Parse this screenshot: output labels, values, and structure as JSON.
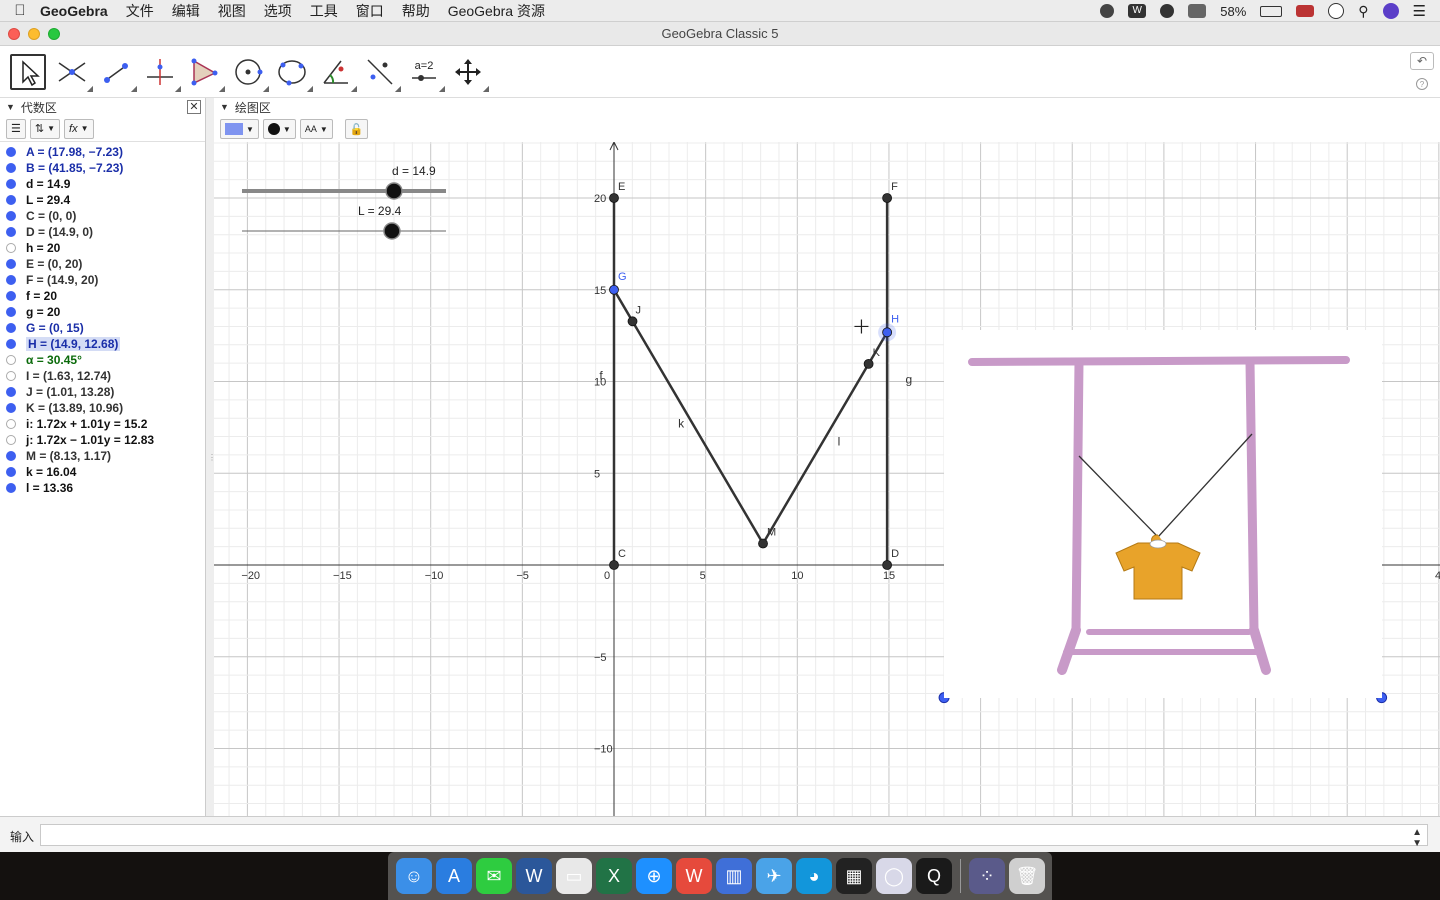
{
  "menubar": {
    "app_name": "GeoGebra",
    "items": [
      "文件",
      "编辑",
      "视图",
      "选项",
      "工具",
      "窗口",
      "帮助",
      "GeoGebra 资源"
    ],
    "battery": "58%",
    "status_icons": [
      "record-icon",
      "wps-icon",
      "sync-icon",
      "cloud-icon",
      "battery-icon",
      "flag-icon",
      "clock-icon",
      "search-icon",
      "siri-icon",
      "list-icon"
    ]
  },
  "window": {
    "title": "GeoGebra Classic 5"
  },
  "toolbar": {
    "tools": [
      "move-tool",
      "point-intersect-tool",
      "line-tool",
      "perpendicular-tool",
      "polygon-tool",
      "circle-tool",
      "circle-three-points-tool",
      "angle-tool",
      "reflect-tool",
      "slider-tool",
      "move-graphics-tool"
    ],
    "slider_tool_label": "a=2",
    "undo": "↶",
    "help": "?"
  },
  "algebra": {
    "title": "代数区",
    "close": "✕",
    "fx_label": "fx",
    "rows": [
      {
        "text": "A = (17.98, −7.23)",
        "visible": true,
        "color": "#1a2ea8"
      },
      {
        "text": "B = (41.85, −7.23)",
        "visible": true,
        "color": "#1a2ea8"
      },
      {
        "text": "d = 14.9",
        "visible": true,
        "color": "#111111"
      },
      {
        "text": "L = 29.4",
        "visible": true,
        "color": "#111111"
      },
      {
        "text": "C = (0, 0)",
        "visible": true,
        "color": "#333333"
      },
      {
        "text": "D = (14.9, 0)",
        "visible": true,
        "color": "#333333"
      },
      {
        "text": "h = 20",
        "visible": false,
        "color": "#111111"
      },
      {
        "text": "E = (0, 20)",
        "visible": true,
        "color": "#333333"
      },
      {
        "text": "F = (14.9, 20)",
        "visible": true,
        "color": "#333333"
      },
      {
        "text": "f = 20",
        "visible": true,
        "color": "#111111"
      },
      {
        "text": "g = 20",
        "visible": true,
        "color": "#111111"
      },
      {
        "text": "G = (0, 15)",
        "visible": true,
        "color": "#1a2ea8"
      },
      {
        "text": "H = (14.9, 12.68)",
        "visible": true,
        "color": "#1a2ea8",
        "selected": true
      },
      {
        "text": "α = 30.45°",
        "visible": false,
        "color": "#0a6a0a"
      },
      {
        "text": "I = (1.63, 12.74)",
        "visible": false,
        "color": "#333333"
      },
      {
        "text": "J = (1.01, 13.28)",
        "visible": true,
        "color": "#333333"
      },
      {
        "text": "K = (13.89, 10.96)",
        "visible": true,
        "color": "#333333"
      },
      {
        "text": "i: 1.72x + 1.01y = 15.2",
        "visible": false,
        "color": "#111111"
      },
      {
        "text": "j: 1.72x − 1.01y = 12.83",
        "visible": false,
        "color": "#111111"
      },
      {
        "text": "M = (8.13, 1.17)",
        "visible": true,
        "color": "#333333"
      },
      {
        "text": "k = 16.04",
        "visible": true,
        "color": "#111111"
      },
      {
        "text": "l = 13.36",
        "visible": true,
        "color": "#111111"
      }
    ]
  },
  "graphics": {
    "title": "绘图区",
    "accent_color": "#7f94f0",
    "font_button": "AA",
    "x_ticks": [
      "−20",
      "−15",
      "−10",
      "−5",
      "0",
      "5",
      "10",
      "15",
      "4"
    ],
    "y_ticks": [
      "20",
      "15",
      "10",
      "5",
      "−5",
      "−10"
    ],
    "sliders": [
      {
        "label": "d = 14.9",
        "min": 0,
        "max": 20,
        "value": 14.9
      },
      {
        "label": "L = 29.4",
        "min": 0,
        "max": 40,
        "value": 29.4
      }
    ],
    "point_labels": [
      "E",
      "F",
      "G",
      "H",
      "J",
      "K",
      "M",
      "C",
      "D"
    ],
    "segment_labels": [
      "k",
      "l",
      "f",
      "g"
    ],
    "points": {
      "C": [
        0,
        0
      ],
      "D": [
        14.9,
        0
      ],
      "E": [
        0,
        20
      ],
      "F": [
        14.9,
        20
      ],
      "G": [
        0,
        15
      ],
      "H": [
        14.9,
        12.68
      ],
      "J": [
        1.01,
        13.28
      ],
      "K": [
        13.89,
        10.96
      ],
      "M": [
        8.13,
        1.17
      ],
      "A": [
        17.98,
        -7.23
      ],
      "B": [
        41.85,
        -7.23
      ]
    }
  },
  "input": {
    "label": "输入",
    "value": "",
    "placeholder": ""
  },
  "dock": {
    "icons": [
      "finder-icon",
      "app-store-icon",
      "wechat-icon",
      "word-icon",
      "preview-icon",
      "excel-icon",
      "safari-icon",
      "wps-icon",
      "books-icon",
      "xcode-icon",
      "qq-icon",
      "piano-icon",
      "geogebra-icon",
      "quicktime-icon",
      "launchpad-icon",
      "trash-icon"
    ]
  }
}
